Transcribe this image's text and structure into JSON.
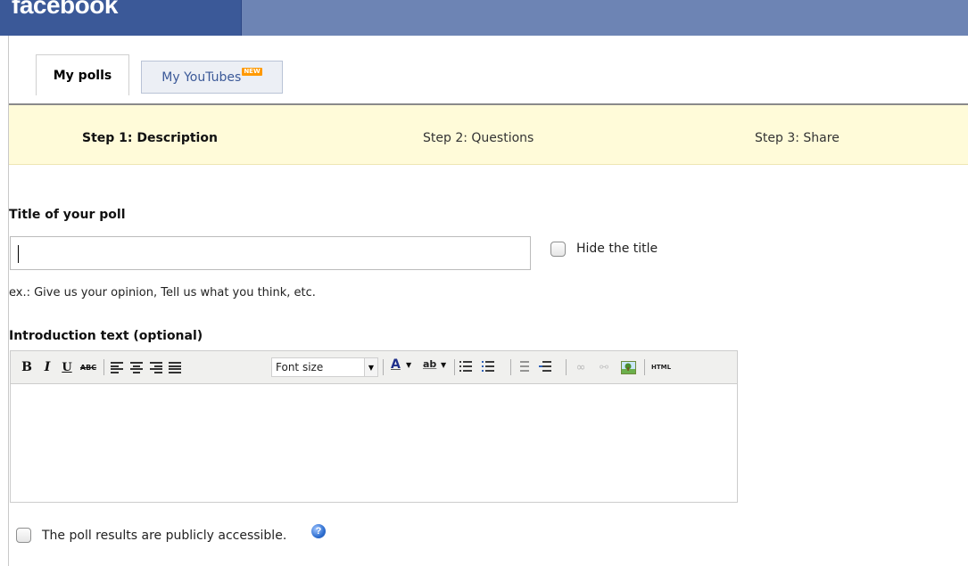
{
  "header": {
    "logo": "facebook",
    "colors": {
      "bar": "#6d84b4",
      "logo_bg": "#3b5998"
    }
  },
  "tabs": [
    {
      "label": "My polls",
      "active": true
    },
    {
      "label": "My YouTubes",
      "badge": "NEW",
      "active": false
    }
  ],
  "steps": [
    {
      "label": "Step 1: Description",
      "active": true
    },
    {
      "label": "Step 2: Questions",
      "active": false
    },
    {
      "label": "Step 3: Share",
      "active": false
    }
  ],
  "form": {
    "title_label": "Title of your poll",
    "title_value": "",
    "hide_title_label": "Hide the title",
    "hide_title_checked": false,
    "title_hint": "ex.: Give us your opinion, Tell us what you think, etc.",
    "intro_label": "Introduction text (optional)",
    "public_label": "The poll results are publicly accessible.",
    "public_checked": false
  },
  "editor": {
    "toolbar": {
      "bold": "B",
      "italic": "I",
      "underline": "U",
      "strike": "ABC",
      "font_size": "Font size",
      "text_color_glyph": "A",
      "highlight_glyph": "ab",
      "html": "HTML"
    },
    "content": ""
  }
}
